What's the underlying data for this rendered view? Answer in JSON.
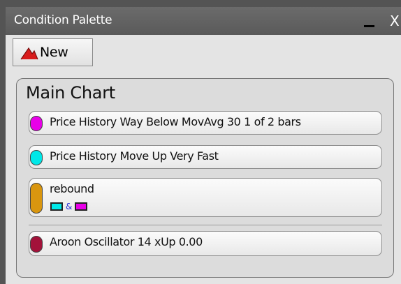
{
  "window": {
    "title": "Condition Palette",
    "close_label": "X"
  },
  "toolbar": {
    "new_label": "New",
    "new_icon": "red-chart-peak-icon"
  },
  "panel": {
    "title": "Main Chart",
    "conditions": [
      {
        "label": "Price History Way Below MovAvg 30 1 of 2 bars",
        "color": "#e800e8"
      },
      {
        "label": "Price History Move Up Very Fast",
        "color": "#00e8e8"
      },
      {
        "label": "rebound",
        "color": "#d9960f",
        "combo": {
          "left_color": "#00e8e8",
          "operator": "&",
          "right_color": "#e800e8"
        }
      },
      {
        "label": "Aroon Oscillator 14 xUp 0.00",
        "color": "#a3123a"
      }
    ]
  }
}
